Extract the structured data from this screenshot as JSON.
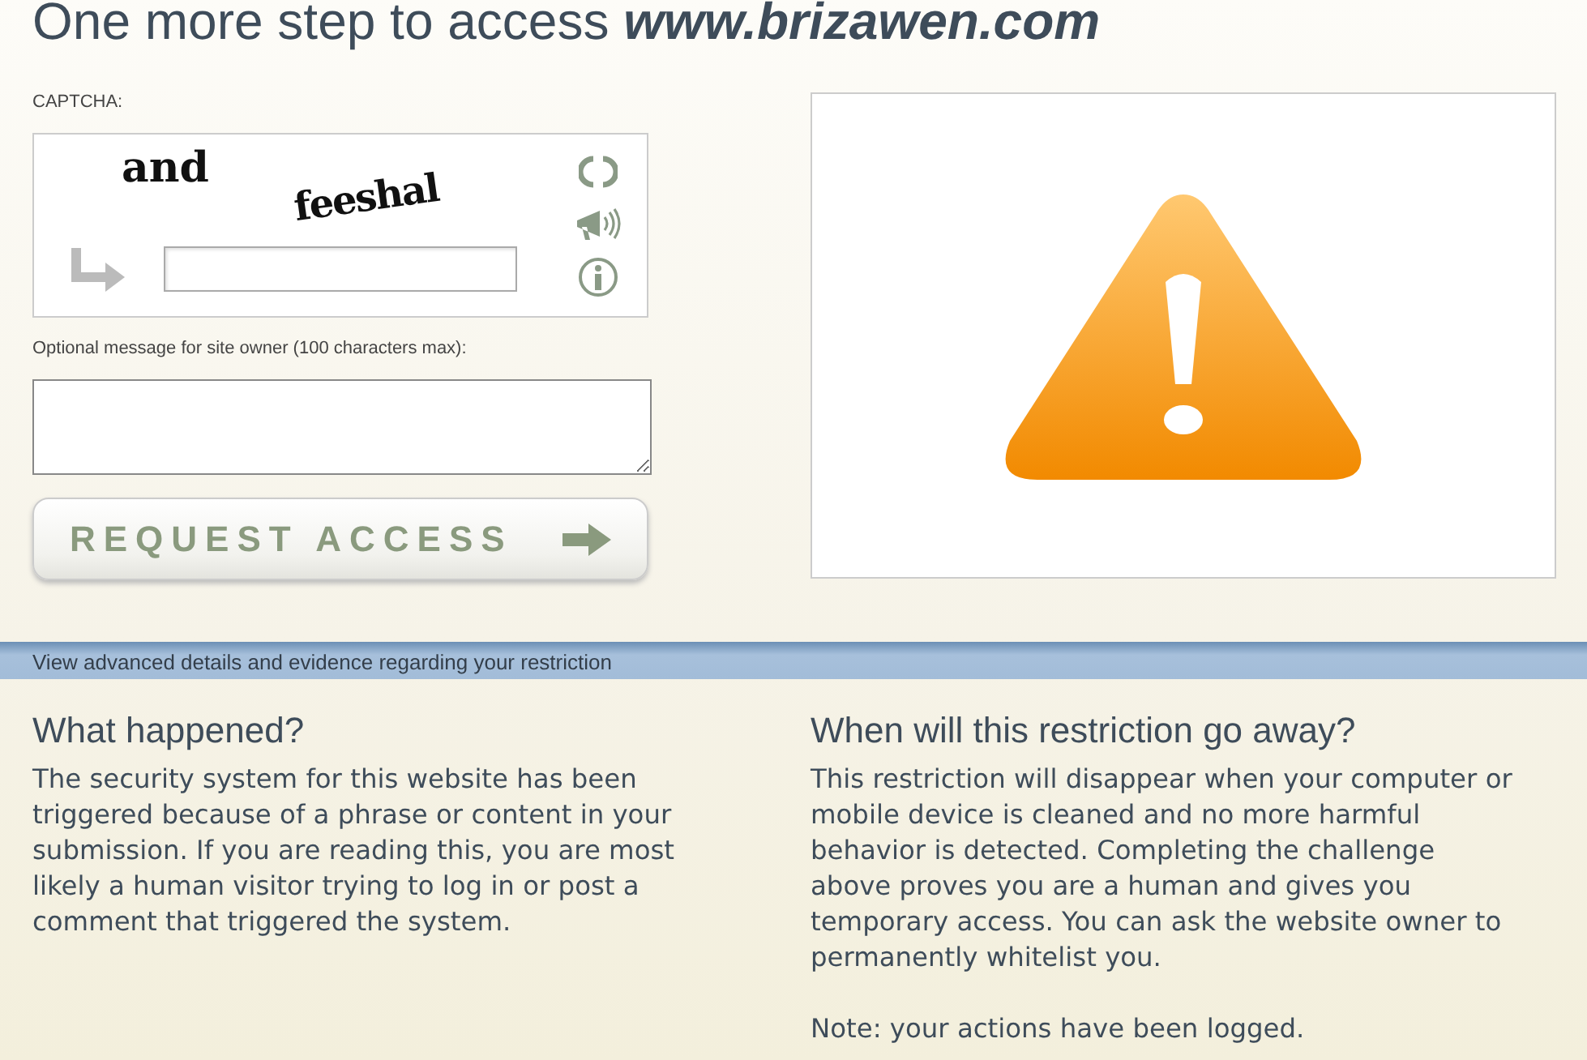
{
  "title": {
    "text": "One more step to access ",
    "site": "www.brizawen.com"
  },
  "captcha": {
    "label": "CAPTCHA:",
    "words": [
      "and",
      "feeshal"
    ]
  },
  "message": {
    "label": "Optional message for site owner (100 characters max):"
  },
  "button": "REQUEST ACCESS",
  "details_bar": "View advanced details and evidence regarding your restriction",
  "sections": [
    {
      "heading": "What happened?",
      "paragraphs": [
        "The security system for this website has been triggered because of a phrase or content in your submission. If you are reading this, you are most likely a human visitor trying to log in or post a comment that triggered the system."
      ]
    },
    {
      "heading": "When will this restriction go away?",
      "paragraphs": [
        "This restriction will disappear when your computer or mobile device is cleaned and no more harmful behavior is detected. Completing the challenge above proves you are a human and gives you temporary access. You can ask the website owner to permanently whitelist you.",
        "Note: your actions have been logged."
      ]
    }
  ]
}
